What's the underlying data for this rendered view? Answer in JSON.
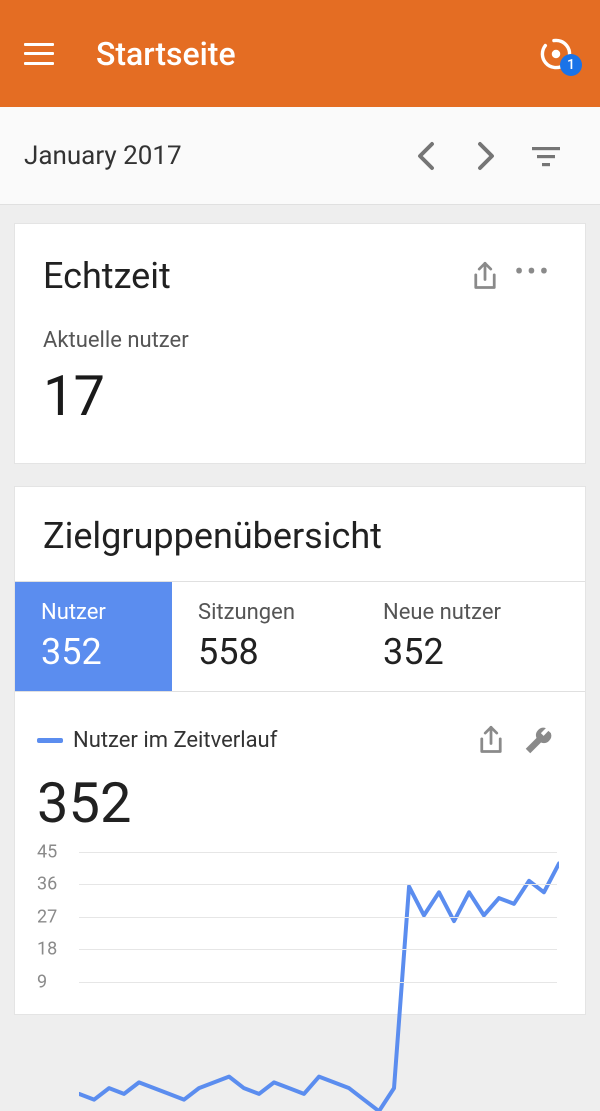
{
  "header": {
    "title": "Startseite",
    "badge": "1"
  },
  "datebar": {
    "label": "January 2017"
  },
  "realtime": {
    "title": "Echtzeit",
    "sub": "Aktuelle nutzer",
    "value": "17"
  },
  "audience": {
    "title": "Zielgruppenübersicht",
    "tabs": [
      {
        "label": "Nutzer",
        "value": "352"
      },
      {
        "label": "Sitzungen",
        "value": "558"
      },
      {
        "label": "Neue nutzer",
        "value": "352"
      }
    ]
  },
  "chart": {
    "legend": "Nutzer im Zeitverlauf",
    "value": "352"
  },
  "chart_data": {
    "type": "line",
    "title": "Nutzer im Zeitverlauf",
    "ylabel": "",
    "xlabel": "",
    "ylim": [
      0,
      45
    ],
    "yticks": [
      9,
      18,
      27,
      36,
      45
    ],
    "values": [
      3,
      2,
      4,
      3,
      5,
      4,
      3,
      2,
      4,
      5,
      6,
      4,
      3,
      5,
      4,
      3,
      6,
      5,
      4,
      2,
      0,
      4,
      39,
      34,
      38,
      33,
      38,
      34,
      37,
      36,
      40,
      38,
      43
    ]
  },
  "colors": {
    "accent": "#e46d23",
    "primary": "#5b8def",
    "badge": "#1a73e8"
  }
}
